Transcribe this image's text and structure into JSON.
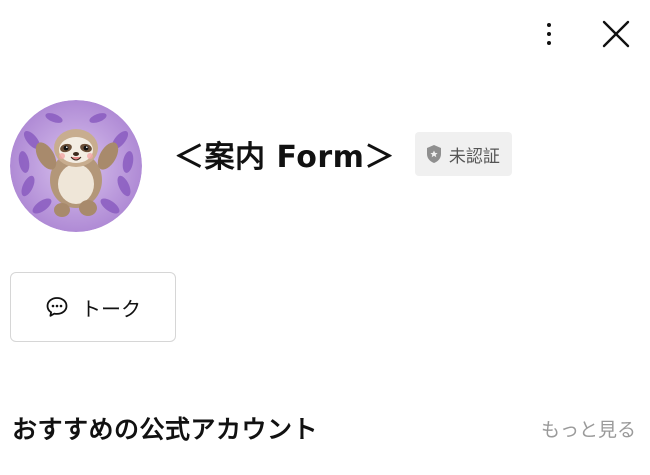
{
  "header": {
    "menu_icon": "more-vertical-icon",
    "close_icon": "close-icon"
  },
  "profile": {
    "account_name": "＜案内 Form＞",
    "badge_label": "未認証",
    "badge_icon": "shield-icon",
    "avatar_description": "sloth-avatar"
  },
  "actions": {
    "talk_label": "トーク",
    "talk_icon": "chat-bubble-icon"
  },
  "recommended": {
    "title": "おすすめの公式アカウント",
    "see_more_label": "もっと見る"
  },
  "colors": {
    "badge_bg": "#f0f0f0",
    "avatar_bg": "#b894d6",
    "muted_text": "#9a9a9a"
  }
}
